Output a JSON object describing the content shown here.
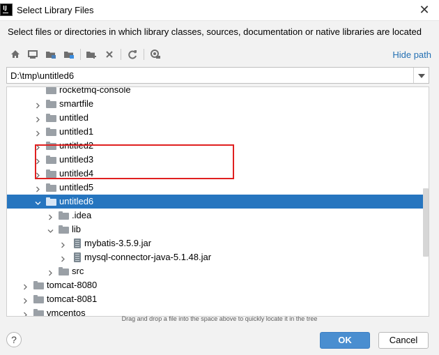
{
  "window": {
    "title": "Select Library Files",
    "app_icon": "intellij-idea-icon",
    "close_label": "✕"
  },
  "description": "Select files or directories in which library classes, sources, documentation or native libraries are located",
  "toolbar": {
    "buttons": [
      {
        "name": "home-icon"
      },
      {
        "name": "desktop-icon"
      },
      {
        "name": "project-folder-icon"
      },
      {
        "name": "module-folder-icon"
      },
      {
        "name": "new-folder-icon"
      },
      {
        "name": "delete-icon"
      },
      {
        "name": "refresh-icon"
      },
      {
        "name": "show-hidden-icon"
      }
    ],
    "hide_path_label": "Hide path"
  },
  "path": {
    "value": "D:\\tmp\\untitled6"
  },
  "tree": {
    "rows": [
      {
        "label": "rocketmq-console",
        "type": "folder",
        "expanded": false
      },
      {
        "label": "smartfile",
        "type": "folder",
        "expanded": false
      },
      {
        "label": "untitled",
        "type": "folder",
        "expanded": false
      },
      {
        "label": "untitled1",
        "type": "folder",
        "expanded": false
      },
      {
        "label": "untitled2",
        "type": "folder",
        "expanded": false
      },
      {
        "label": "untitled3",
        "type": "folder",
        "expanded": false
      },
      {
        "label": "untitled4",
        "type": "folder",
        "expanded": false
      },
      {
        "label": "untitled5",
        "type": "folder",
        "expanded": false
      },
      {
        "label": "untitled6",
        "type": "folder",
        "expanded": true,
        "selected": true
      },
      {
        "label": ".idea",
        "type": "folder",
        "expanded": false
      },
      {
        "label": "lib",
        "type": "folder",
        "expanded": true
      },
      {
        "label": "mybatis-3.5.9.jar",
        "type": "jar",
        "expanded": false
      },
      {
        "label": "mysql-connector-java-5.1.48.jar",
        "type": "jar",
        "expanded": false
      },
      {
        "label": "src",
        "type": "folder",
        "expanded": false
      },
      {
        "label": "tomcat-8080",
        "type": "folder",
        "expanded": false
      },
      {
        "label": "tomcat-8081",
        "type": "folder",
        "expanded": false
      },
      {
        "label": "vmcentos",
        "type": "folder",
        "expanded": false
      }
    ]
  },
  "hint": "Drag and drop a file into the space above to quickly locate it in the tree",
  "buttons": {
    "help": "?",
    "ok": "OK",
    "cancel": "Cancel"
  },
  "colors": {
    "selection": "#2675bf",
    "link": "#2470b3",
    "ok_button": "#4a8ed0",
    "highlight_box": "#e02020"
  }
}
